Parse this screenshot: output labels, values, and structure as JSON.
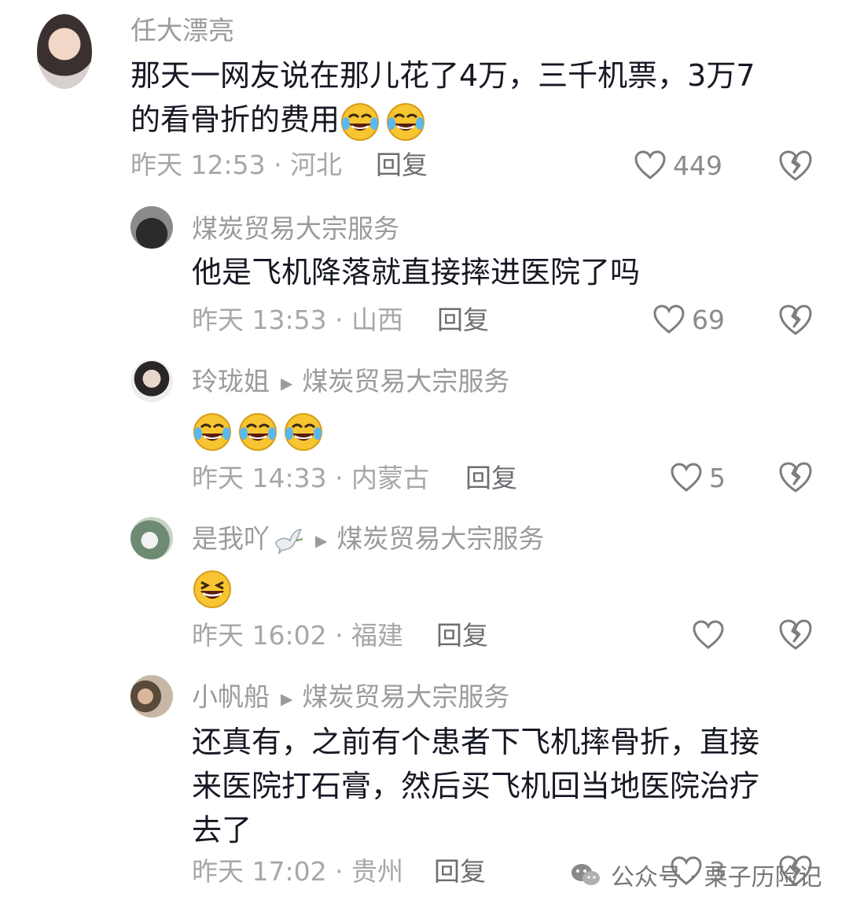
{
  "comments": [
    {
      "username": "任大漂亮",
      "text_lines": [
        "那天一网友说在那儿花了4万，三千机票，3万7",
        "的看骨折的费用"
      ],
      "emoji_count": 2,
      "meta": "昨天 12:53 · 河北",
      "reply_label": "回复",
      "likes": "449"
    },
    {
      "username": "煤炭贸易大宗服务",
      "text_lines": [
        "他是飞机降落就直接摔进医院了吗"
      ],
      "meta": "昨天 13:53 · 山西",
      "reply_label": "回复",
      "likes": "69"
    },
    {
      "username": "玲珑姐",
      "reply_to": "煤炭贸易大宗服务",
      "emoji_count": 3,
      "meta": "昨天 14:33 · 内蒙古",
      "reply_label": "回复",
      "likes": "5"
    },
    {
      "username": "是我吖",
      "reply_to": "煤炭贸易大宗服务",
      "emoji_count": 1,
      "meta": "昨天 16:02 · 福建",
      "reply_label": "回复",
      "likes": ""
    },
    {
      "username": "小帆船",
      "reply_to": "煤炭贸易大宗服务",
      "text_lines": [
        "还真有，之前有个患者下飞机摔骨折，直接",
        "来医院打石膏，然后买飞机回当地医院治疗",
        "去了"
      ],
      "meta": "昨天 17:02 · 贵州",
      "reply_label": "回复",
      "likes": "3"
    }
  ],
  "watermark": "公众号 · 栗子历险记",
  "icons": {
    "like": "heart-outline-icon",
    "dislike": "broken-heart-icon",
    "laugh": "laughing-tears-emoji",
    "grin": "grinning-emoji",
    "dove": "dove-icon",
    "wechat": "wechat-icon",
    "reply_arrow": "triangle-right-icon"
  }
}
